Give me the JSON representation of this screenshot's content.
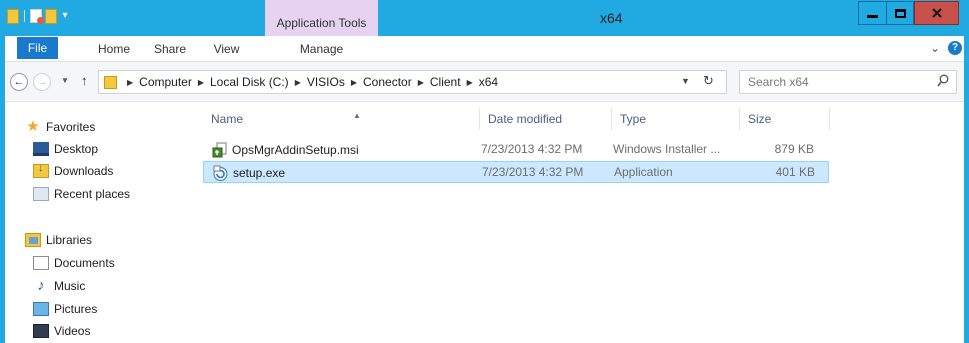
{
  "window": {
    "title": "x64",
    "context_tab": "Application Tools",
    "accent_color": "#21a9e1",
    "close_color": "#c7504a"
  },
  "ribbon": {
    "tabs": [
      "File",
      "Home",
      "Share",
      "View",
      "Manage"
    ],
    "help_label": "?"
  },
  "navigation": {
    "breadcrumb": [
      "Computer",
      "Local Disk (C:)",
      "VISIOs",
      "Conector",
      "Client",
      "x64"
    ],
    "search_placeholder": "Search x64"
  },
  "sidebar": {
    "favorites_label": "Favorites",
    "favorites": [
      "Desktop",
      "Downloads",
      "Recent places"
    ],
    "libraries_label": "Libraries",
    "libraries": [
      "Documents",
      "Music",
      "Pictures",
      "Videos"
    ]
  },
  "file_list": {
    "columns": [
      "Name",
      "Date modified",
      "Type",
      "Size"
    ],
    "sort_column": "Name",
    "rows": [
      {
        "name": "OpsMgrAddinSetup.msi",
        "date_modified": "7/23/2013 4:32 PM",
        "type": "Windows Installer ...",
        "size": "879 KB",
        "icon": "msi-installer-icon",
        "selected": false
      },
      {
        "name": "setup.exe",
        "date_modified": "7/23/2013 4:32 PM",
        "type": "Application",
        "size": "401 KB",
        "icon": "setup-exe-icon",
        "selected": true
      }
    ]
  }
}
